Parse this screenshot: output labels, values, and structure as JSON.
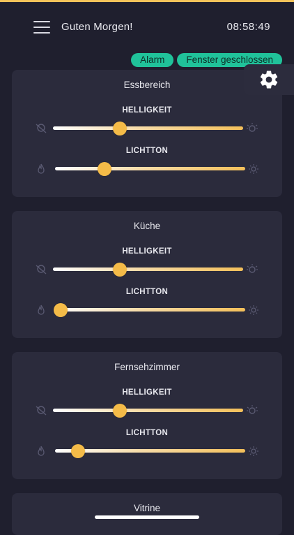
{
  "header": {
    "greeting": "Guten Morgen!",
    "time": "08:58:49"
  },
  "badges": [
    {
      "label": "Alarm"
    },
    {
      "label": "Fenster geschlossen"
    }
  ],
  "colors": {
    "background": "#1f1f2e",
    "card": "#2b2b3c",
    "accent": "#f4bb48",
    "badge": "#20c29a"
  },
  "rooms": [
    {
      "name": "Essbereich",
      "brightness": {
        "label": "HELLIGKEIT",
        "value": 0.35
      },
      "tone": {
        "label": "LICHTTON",
        "value": 0.26
      }
    },
    {
      "name": "Küche",
      "brightness": {
        "label": "HELLIGKEIT",
        "value": 0.35
      },
      "tone": {
        "label": "LICHTTON",
        "value": 0.03
      }
    },
    {
      "name": "Fernsehzimmer",
      "brightness": {
        "label": "HELLIGKEIT",
        "value": 0.35
      },
      "tone": {
        "label": "LICHTTON",
        "value": 0.12
      }
    },
    {
      "name": "Vitrine"
    }
  ]
}
